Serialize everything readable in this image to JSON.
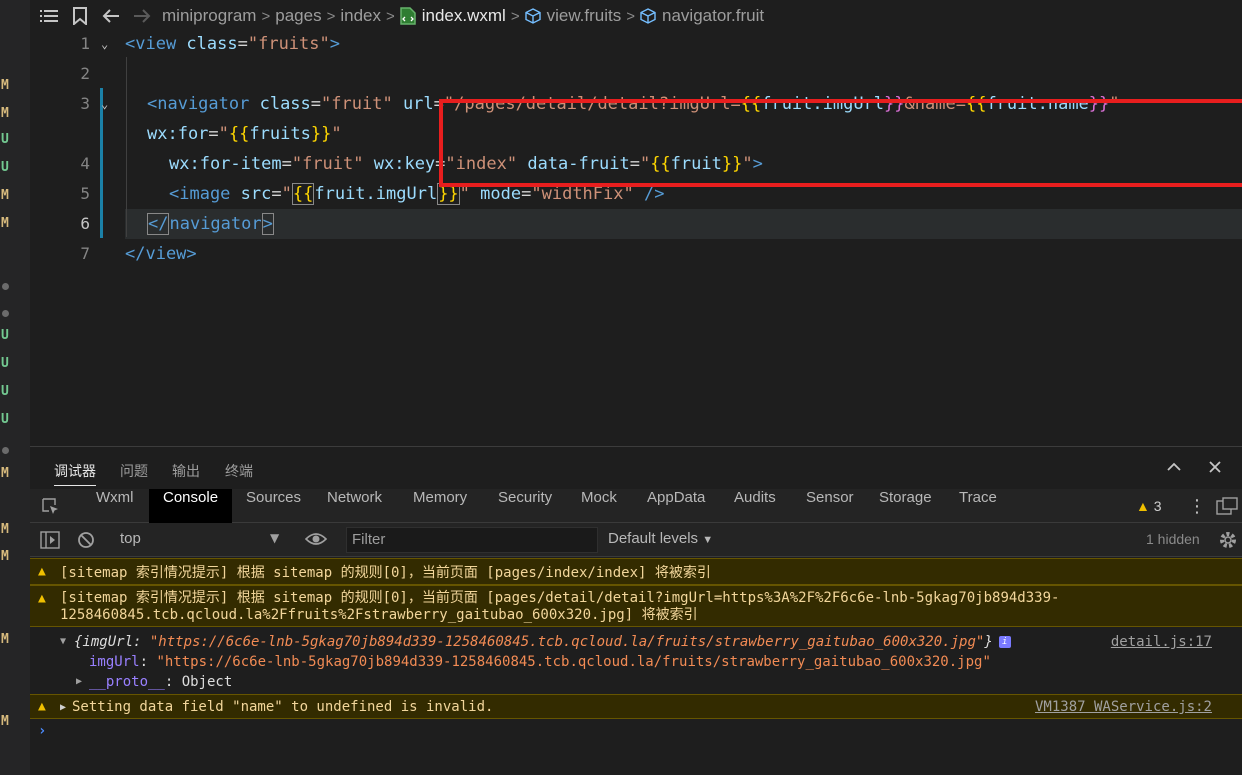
{
  "left_strip": {
    "markers": [
      {
        "t": "M",
        "kind": "M"
      },
      {
        "t": "M",
        "kind": "M"
      },
      {
        "t": "U",
        "kind": "U"
      },
      {
        "t": "U",
        "kind": "U"
      },
      {
        "t": "M",
        "kind": "M"
      },
      {
        "t": "M",
        "kind": "M"
      },
      {
        "t": "U",
        "kind": "U"
      },
      {
        "t": "U",
        "kind": "U"
      },
      {
        "t": "U",
        "kind": "U"
      },
      {
        "t": "U",
        "kind": "U"
      },
      {
        "t": "M",
        "kind": "M"
      },
      {
        "t": "M",
        "kind": "M"
      },
      {
        "t": "M",
        "kind": "M"
      },
      {
        "t": "M",
        "kind": "M"
      },
      {
        "t": "M",
        "kind": "M"
      }
    ]
  },
  "breadcrumb": {
    "items": [
      "miniprogram",
      "pages",
      "index",
      "index.wxml",
      "view.fruits",
      "navigator.fruit"
    ],
    "separator": ">"
  },
  "editor": {
    "line_numbers": [
      "1",
      "2",
      "3",
      "4",
      "5",
      "6",
      "7"
    ],
    "line1": {
      "open": "<view ",
      "attr": "class",
      "eq": "=",
      "val": "\"fruits\"",
      "close": ">"
    },
    "line3a": {
      "open": "<navigator ",
      "attr1": "class",
      "val1": "\"fruit\"",
      "attr2": "url",
      "q1": "\"",
      "path": "/pages/detail/detail?imgUrl=",
      "b1": "{{",
      "expr1": "fruit.imgUrl",
      "b2": "}}",
      "mid": "&name=",
      "b3": "{{",
      "expr2": "fruit.name",
      "b4": "}}",
      "q2": "\""
    },
    "line3b": {
      "attr": "wx:for",
      "q1": "\"",
      "b1": "{{",
      "expr": "fruits",
      "b2": "}}",
      "q2": "\""
    },
    "line4": {
      "attr1": "wx:for-item",
      "val1": "\"fruit\"",
      "attr2": "wx:key",
      "val2": "\"index\"",
      "attr3": "data-fruit",
      "q1": "\"",
      "b1": "{{",
      "expr": "fruit",
      "b2": "}}",
      "q2": "\"",
      "close": ">"
    },
    "line5": {
      "open": "<image ",
      "attr1": "src",
      "q1": "\"",
      "b1": "{{",
      "expr": "fruit.imgUrl",
      "b2": "}}",
      "q2": "\"",
      "attr2": "mode",
      "val2": "\"widthFix\"",
      "close": " />"
    },
    "line6": {
      "open": "</",
      "name": "navigator",
      "close": ">"
    },
    "line7": {
      "text": "</view>"
    }
  },
  "panel": {
    "tabs": [
      "调试器",
      "问题",
      "输出",
      "终端"
    ],
    "devtools_tabs": [
      "Wxml",
      "Console",
      "Sources",
      "Network",
      "Memory",
      "Security",
      "Mock",
      "AppData",
      "Audits",
      "Sensor",
      "Storage",
      "Trace"
    ],
    "warning_count": "3",
    "context": "top",
    "filter_placeholder": "Filter",
    "levels": "Default levels",
    "hidden": "1 hidden"
  },
  "console": {
    "msg1": "[sitemap 索引情况提示] 根据 sitemap 的规则[0]，当前页面 [pages/index/index] 将被索引",
    "msg2_line1": "[sitemap 索引情况提示] 根据 sitemap 的规则[0]，当前页面 [pages/detail/detail?imgUrl=https%3A%2F%2F6c6e-lnb-5gkag70jb894d339-",
    "msg2_line2": "1258460845.tcb.qcloud.la%2Ffruits%2Fstrawberry_gaitubao_600x320.jpg] 将被索引",
    "obj_open": "{imgUrl: ",
    "obj_val": "\"https://6c6e-lnb-5gkag70jb894d339-1258460845.tcb.qcloud.la/fruits/strawberry_gaitubao_600x320.jpg\"",
    "obj_close": "}",
    "obj_link": "detail.js:17",
    "prop_key": "imgUrl",
    "prop_val": "\"https://6c6e-lnb-5gkag70jb894d339-1258460845.tcb.qcloud.la/fruits/strawberry_gaitubao_600x320.jpg\"",
    "proto_key": "__proto__",
    "proto_val": ": Object",
    "msg3": "Setting data field \"name\" to undefined is invalid.",
    "msg3_link": "VM1387 WAService.js:2"
  },
  "colors": {
    "highlight_box": "#e81e1e",
    "warning_bg": "#332b00",
    "accent": "#1b81a8"
  }
}
